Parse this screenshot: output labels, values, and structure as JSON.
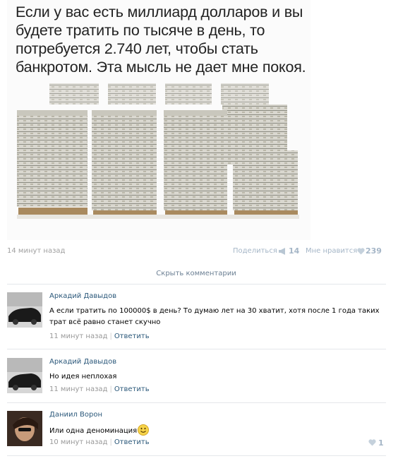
{
  "post": {
    "caption": "Если у вас есть миллиард долларов и вы будете тратить по тысяче в день, то потребуется 2.740 лет, чтобы стать банкротом. Эта мысль не дает мне покоя.",
    "time": "14 минут назад",
    "share_label": "Поделиться",
    "share_count": "14",
    "like_label": "Мне нравится",
    "like_count": "239",
    "icons": {
      "share": "megaphone-icon",
      "like": "heart-icon"
    }
  },
  "comments_toggle": "Скрыть комментарии",
  "comments": [
    {
      "author": "Аркадий Давыдов",
      "text": "А если тратить по 100000$ в день? То думаю лет на 30 хватит, хотя после 1 года таких трат всё равно станет скучно",
      "time": "11 минут назад",
      "reply": "Ответить"
    },
    {
      "author": "Аркадий Давыдов",
      "text": "Но идея неплохая",
      "time": "11 минут назад",
      "reply": "Ответить"
    },
    {
      "author": "Даниил Ворон",
      "text": "Или одна деноминация",
      "time": "10 минут назад",
      "reply": "Ответить",
      "likes": "1",
      "emoji": "smile-emoji-icon"
    }
  ],
  "colors": {
    "link": "#2b587a",
    "muted": "#a0a0a0",
    "action": "#a5b6c7",
    "separator": "#e4e7ea"
  }
}
